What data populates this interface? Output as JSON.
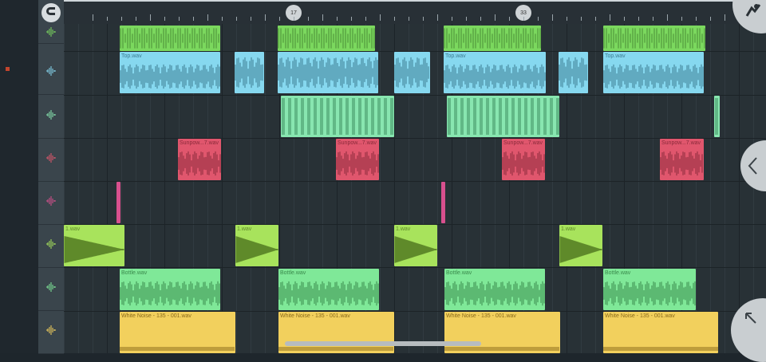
{
  "ruler": {
    "markers": [
      "17",
      "33"
    ]
  },
  "clip_labels": {
    "top": "Top.wav",
    "sunpow": "Sunpow...7.wav",
    "one": "1.wav",
    "bottle": "Bottle.wav",
    "noise": "White Noise - 135 - 001.wav"
  },
  "icons": {
    "magnet": "magnet-icon",
    "fl_logo": "fl-studio-fruit-icon",
    "collapse": "chevron-left-icon",
    "expand": "arrow-up-left-icon",
    "track_heads": "waveform-icon"
  },
  "colors": {
    "green": "#7bd85e",
    "cyan": "#86d8ef",
    "mint": "#88e6b0",
    "red": "#e0566d",
    "magenta": "#d8508e",
    "lime": "#a8e35c",
    "lightgreen": "#7fe898",
    "yellow": "#f2d05d"
  }
}
